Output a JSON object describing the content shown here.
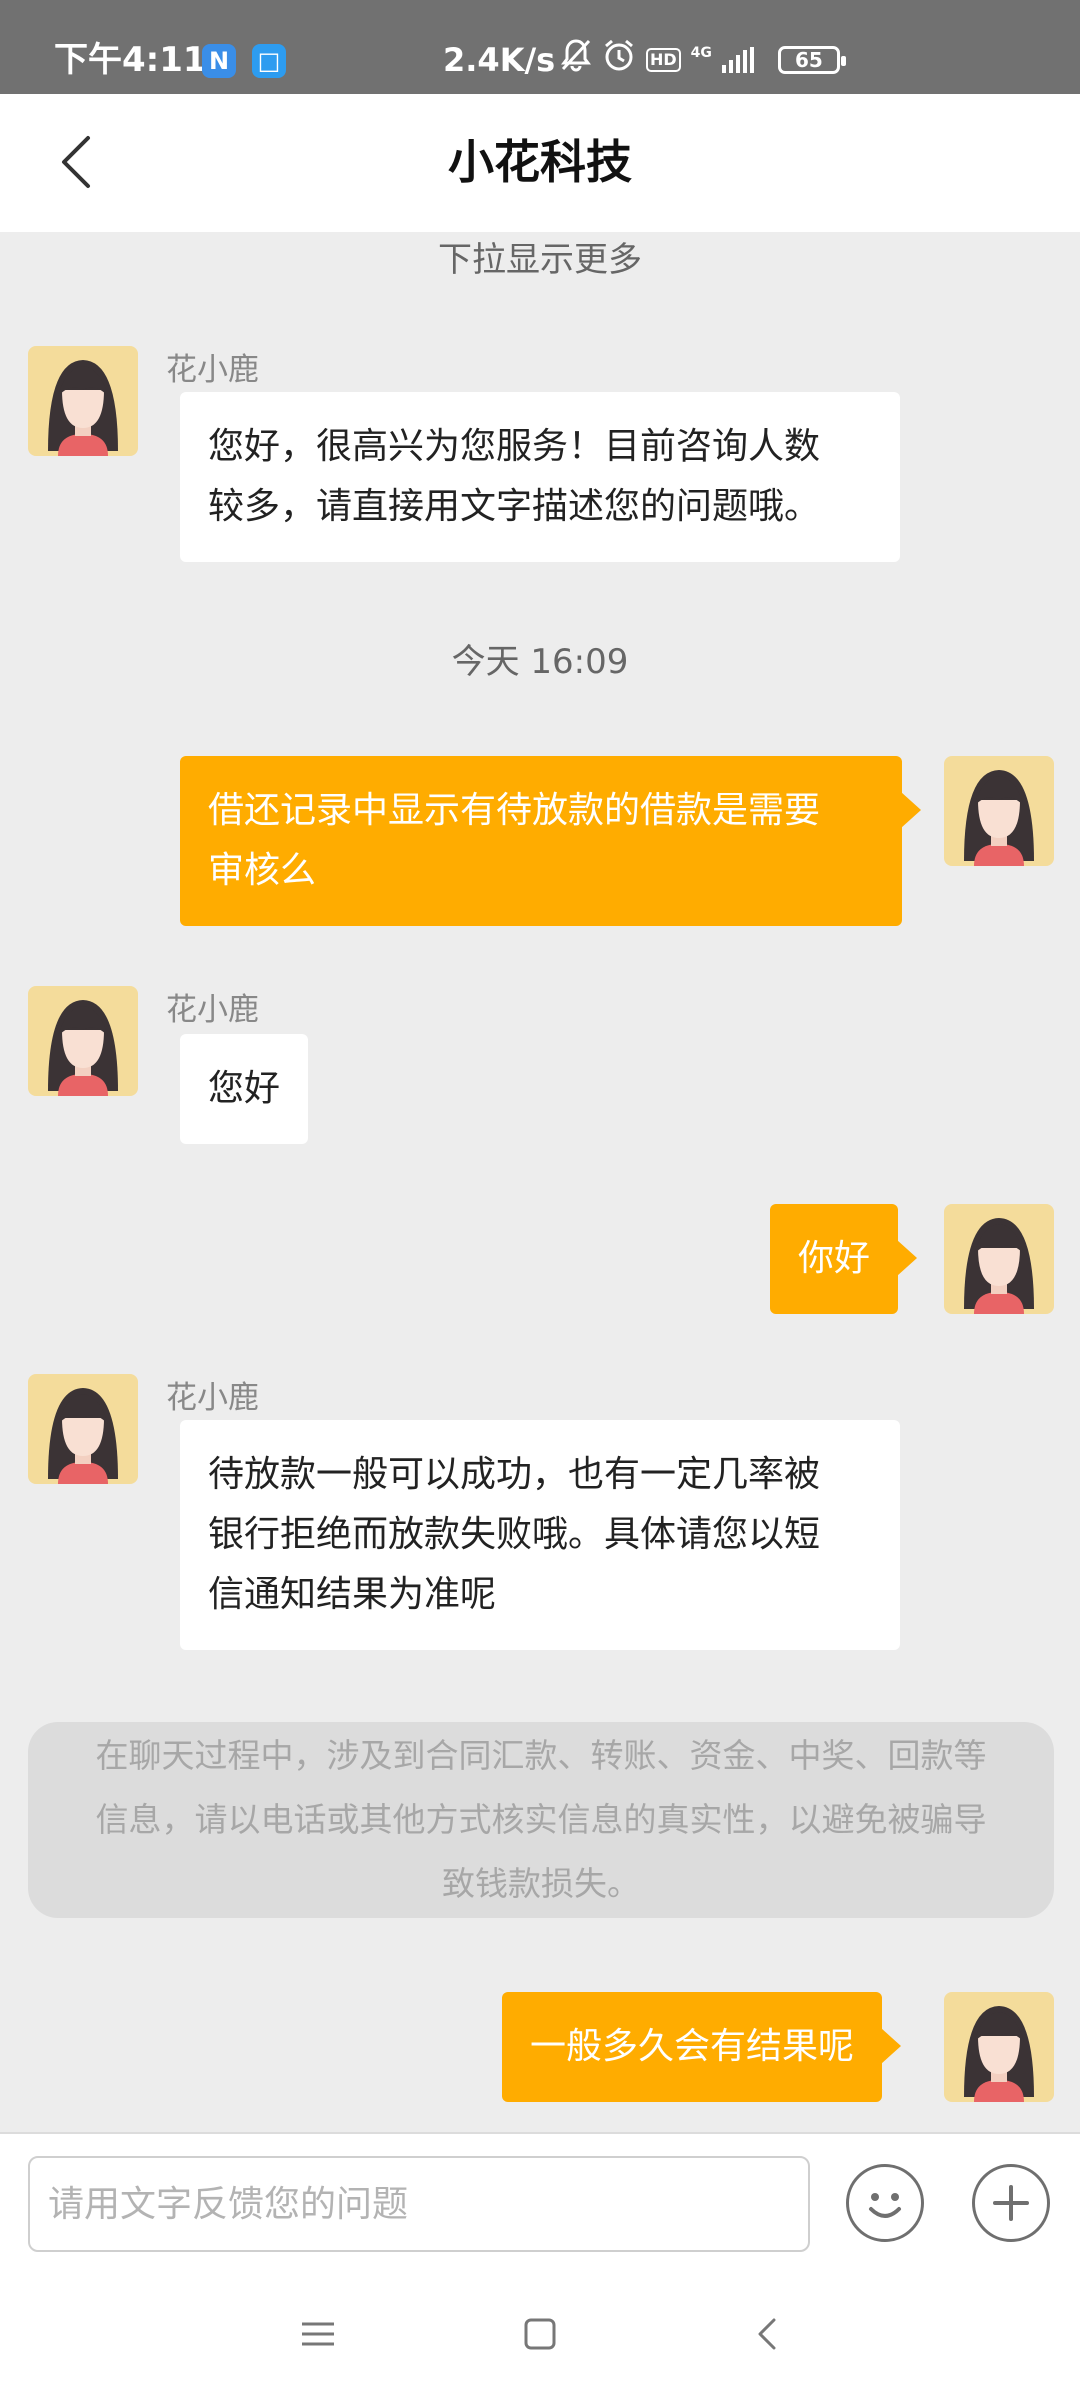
{
  "status_bar": {
    "time": "下午4:11",
    "app_icons": [
      "N",
      "□"
    ],
    "net_speed": "2.4K/s",
    "hd": "HD",
    "network": "4G",
    "battery": "65"
  },
  "header": {
    "title": "小花科技"
  },
  "chat": {
    "pull_hint": "下拉显示更多",
    "timestamp": "今天 16:09",
    "messages": [
      {
        "side": "left",
        "sender": "花小鹿",
        "lines": [
          "您好，很高兴为您服务！目前咨询人数",
          "较多，请直接用文字描述您的问题哦。"
        ]
      },
      {
        "side": "right",
        "lines": [
          "借还记录中显示有待放款的借款是需要",
          "审核么"
        ]
      },
      {
        "side": "left",
        "sender": "花小鹿",
        "lines": [
          "您好"
        ]
      },
      {
        "side": "right",
        "lines": [
          "你好"
        ]
      },
      {
        "side": "left",
        "sender": "花小鹿",
        "lines": [
          "待放款一般可以成功，也有一定几率被",
          "银行拒绝而放款失败哦。具体请您以短",
          "信通知结果为准呢"
        ]
      },
      {
        "side": "right",
        "lines": [
          "一般多久会有结果呢"
        ]
      }
    ],
    "notice_lines": [
      "在聊天过程中，涉及到合同汇款、转账、资金、中奖、回款等",
      "信息，请以电话或其他方式核实信息的真实性，以避免被骗导",
      "致钱款损失。"
    ]
  },
  "input": {
    "placeholder": "请用文字反馈您的问题"
  },
  "icons": {
    "back": "back-arrow-icon",
    "emoji": "smiley-icon",
    "add": "plus-icon",
    "nav_menu": "menu-icon",
    "nav_home": "square-home-icon",
    "nav_back": "back-chevron-icon"
  },
  "colors": {
    "user_bubble": "#ffac00",
    "avatar_bg": "#f4dc9b",
    "page_bg": "#ededed"
  }
}
